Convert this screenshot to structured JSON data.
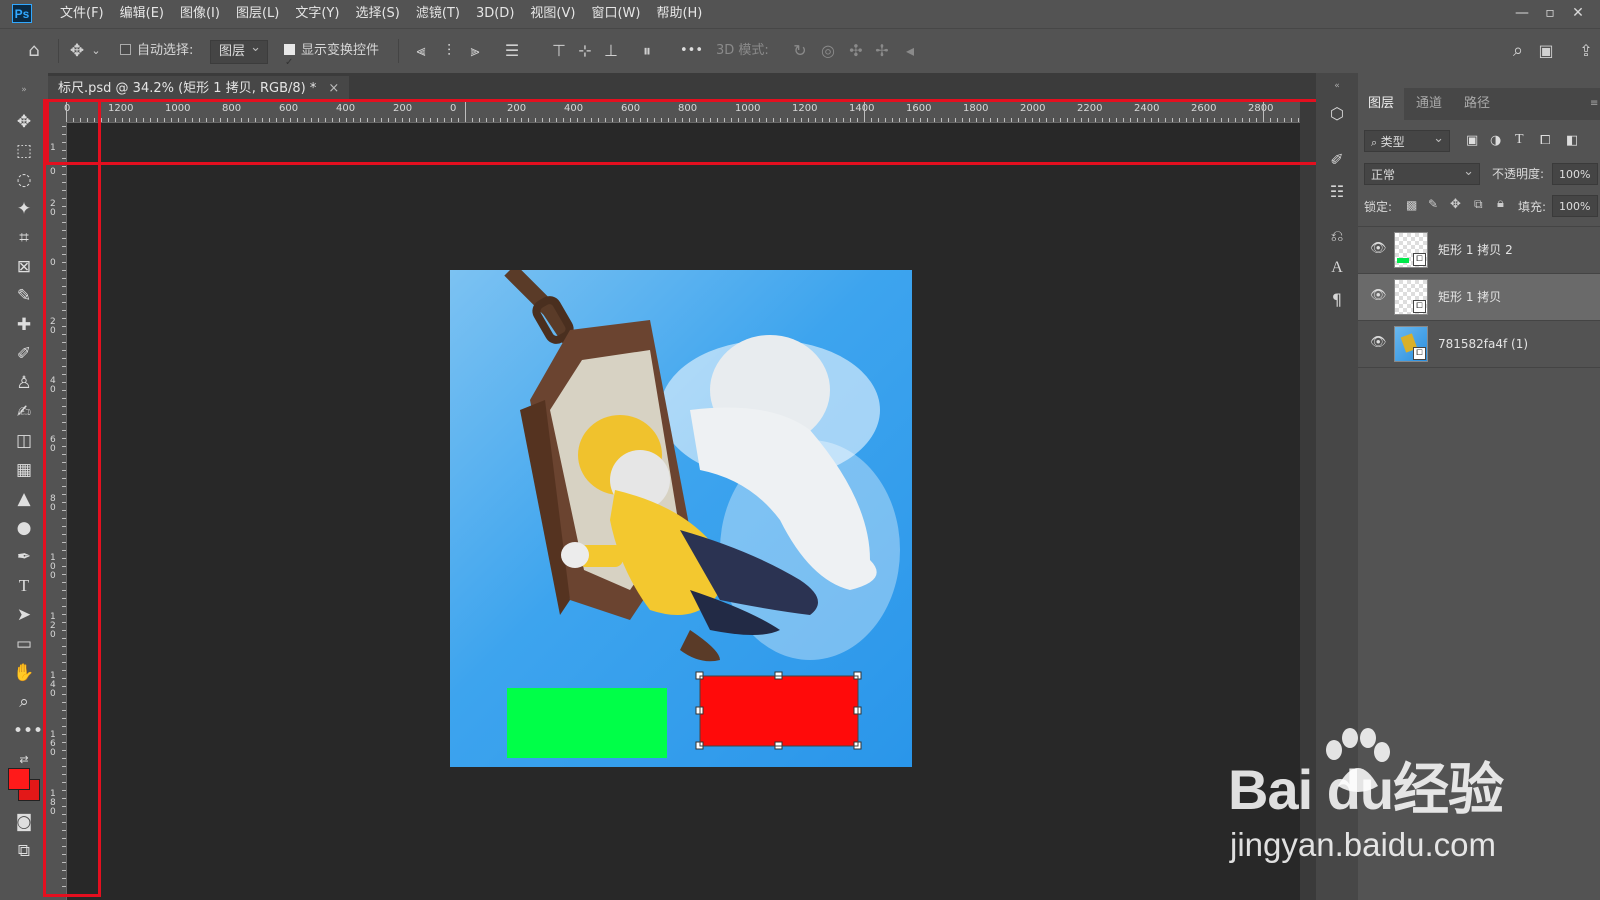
{
  "app": {
    "logo": "Ps"
  },
  "menu": [
    "文件(F)",
    "编辑(E)",
    "图像(I)",
    "图层(L)",
    "文字(Y)",
    "选择(S)",
    "滤镜(T)",
    "3D(D)",
    "视图(V)",
    "窗口(W)",
    "帮助(H)"
  ],
  "options": {
    "auto_select_label": "自动选择:",
    "auto_select_checked": false,
    "auto_select_target": "图层",
    "show_transform_label": "显示变换控件",
    "show_transform_checked": true,
    "more": "•••",
    "mode_3d_label": "3D 模式:"
  },
  "document": {
    "tab_title": "标尺.psd @ 34.2% (矩形 1 拷贝, RGB/8) *",
    "close": "×"
  },
  "ruler": {
    "h_labels": [
      "0",
      "1200",
      "1000",
      "800",
      "600",
      "400",
      "200",
      "0",
      "200",
      "400",
      "600",
      "800",
      "1000",
      "1200",
      "1400",
      "1600",
      "1800",
      "2000",
      "2200",
      "2400",
      "2600",
      "2800"
    ],
    "v_labels": [
      "1",
      "0",
      "2 0",
      "0",
      "2 0",
      "4 0",
      "6 0",
      "8 0",
      "1 0 0",
      "1 2 0",
      "1 4 0",
      "1 6 0",
      "1 8 0"
    ]
  },
  "panel": {
    "tabs": [
      "图层",
      "通道",
      "路径"
    ],
    "active_tab": 0,
    "filter_label": "类型",
    "blend_mode": "正常",
    "opacity_label": "不透明度:",
    "opacity_value": "100%",
    "lock_label": "锁定:",
    "fill_label": "填充:",
    "fill_value": "100%",
    "layers": [
      {
        "name": "矩形 1 拷贝 2",
        "visible": true,
        "selected": false
      },
      {
        "name": "矩形 1 拷贝",
        "visible": true,
        "selected": true
      },
      {
        "name": "781582fa4f (1)",
        "visible": true,
        "selected": false
      }
    ]
  },
  "colors": {
    "foreground": "#ff1a1a",
    "background": "#e31818",
    "highlight": "#e40f1f",
    "green_rect": "#00ff48",
    "red_rect": "#ff0a0a"
  },
  "watermark": {
    "line1": "Bai du经验",
    "line2": "jingyan.baidu.com"
  }
}
